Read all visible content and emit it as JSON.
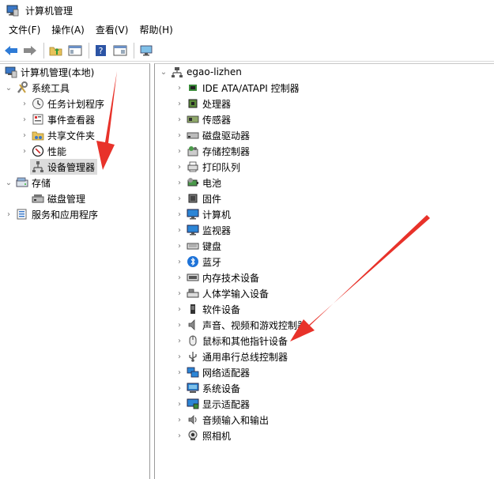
{
  "window": {
    "title": "计算机管理"
  },
  "menu": {
    "file": "文件(F)",
    "action": "操作(A)",
    "view": "查看(V)",
    "help": "帮助(H)"
  },
  "tree": {
    "root": "计算机管理(本地)",
    "system_tools": "系统工具",
    "task_scheduler": "任务计划程序",
    "event_viewer": "事件查看器",
    "shared_folders": "共享文件夹",
    "performance": "性能",
    "device_manager": "设备管理器",
    "storage": "存储",
    "disk_management": "磁盘管理",
    "services_apps": "服务和应用程序"
  },
  "devices": {
    "root": "egao-lizhen",
    "items": [
      "IDE ATA/ATAPI 控制器",
      "处理器",
      "传感器",
      "磁盘驱动器",
      "存储控制器",
      "打印队列",
      "电池",
      "固件",
      "计算机",
      "监视器",
      "键盘",
      "蓝牙",
      "内存技术设备",
      "人体学输入设备",
      "软件设备",
      "声音、视频和游戏控制器",
      "鼠标和其他指针设备",
      "通用串行总线控制器",
      "网络适配器",
      "系统设备",
      "显示适配器",
      "音频输入和输出",
      "照相机"
    ]
  },
  "colors": {
    "arrow": "#e8322a",
    "selection": "#dcdcdc"
  }
}
